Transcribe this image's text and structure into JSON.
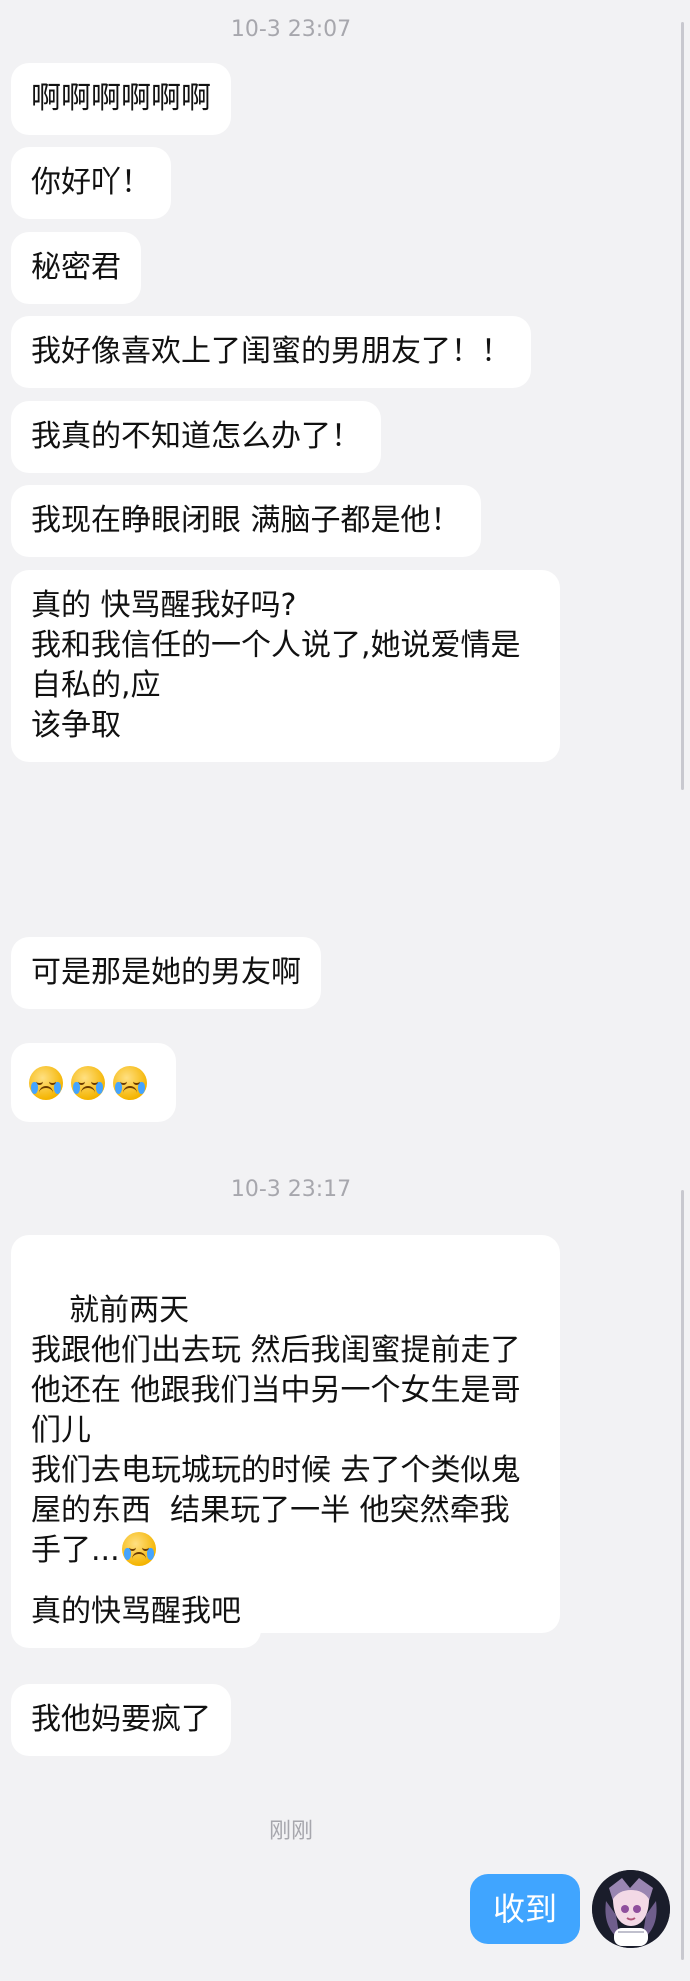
{
  "timestamps": {
    "first": "10-3 23:07",
    "second": "10-3 23:17",
    "recent": "刚刚"
  },
  "messages": [
    "啊啊啊啊啊啊",
    "你好吖！",
    "秘密君",
    "我好像喜欢上了闺蜜的男朋友了！！",
    "我真的不知道怎么办了！",
    "我现在睁眼闭眼 满脑子都是他！",
    "真的 快骂醒我好吗?\n我和我信任的一个人说了,她说爱情是\n自私的,应\n该争取",
    "可是那是她的男友啊",
    "就前两天\n我跟他们出去玩 然后我闺蜜提前走了\n他还在 他跟我们当中另一个女生是哥\n们儿\n我们去电玩城玩的时候 去了个类似鬼\n屋的东西  结果玩了一半 他突然牵我\n手了...",
    "真的快骂醒我吧",
    "我他妈要疯了"
  ],
  "outgoing": {
    "text": "收到"
  },
  "icons": {
    "crying_emoji": "loudly-crying-face-icon",
    "avatar": "user-avatar"
  }
}
